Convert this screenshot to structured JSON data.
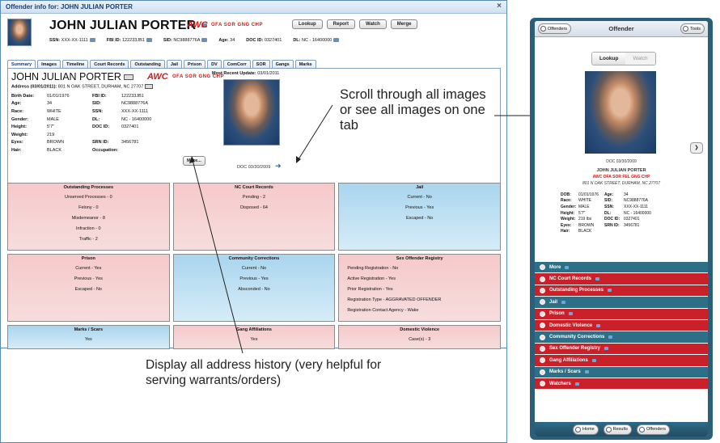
{
  "window": {
    "title": "Offender info for: JOHN JULIAN PORTER",
    "close": "×"
  },
  "header": {
    "name": "JOHN JULIAN PORTER",
    "awc": "AWC",
    "flags": "OFA  SOR  GNG  CHP",
    "buttons": [
      "Lookup",
      "Report",
      "Watch",
      "Merge"
    ],
    "ids": [
      {
        "label": "SSN:",
        "value": "XXX-XX-1111"
      },
      {
        "label": "FBI ID:",
        "value": "122233JB1"
      },
      {
        "label": "SID:",
        "value": "NC9888776A"
      },
      {
        "label": "Age:",
        "value": "34"
      },
      {
        "label": "DOC ID:",
        "value": "0327401"
      },
      {
        "label": "DL:",
        "value": "NC - 16400000"
      }
    ]
  },
  "tabs": [
    "Summary",
    "Images",
    "Timeline",
    "Court Records",
    "Outstanding",
    "Jail",
    "Prison",
    "DV",
    "ComCorr",
    "SOR",
    "Gangs",
    "Marks"
  ],
  "summary": {
    "name": "JOHN JULIAN PORTER",
    "awc": "AWC",
    "flags": "OFA  SOR  GNG  CHP",
    "address_label": "Address (03/01/2011):",
    "address": "801 N OAK STREET, DURHAM, NC 27707",
    "details": [
      [
        "Birth Date:",
        "01/01/1976",
        "FBI ID:",
        "122233JB1"
      ],
      [
        "Age:",
        "34",
        "SID:",
        "NC9888776A"
      ],
      [
        "Race:",
        "WHITE",
        "SSN:",
        "XXX-XX-1111"
      ],
      [
        "Gender:",
        "MALE",
        "DL:",
        "NC - 16400000"
      ],
      [
        "Height:",
        "5'7\"",
        "DOC ID:",
        "0327401"
      ],
      [
        "Weight:",
        "219",
        "",
        ""
      ],
      [
        "Eyes:",
        "BROWN",
        "SRN ID:",
        "3456781"
      ],
      [
        "Hair:",
        "BLACK",
        "Occupation:",
        ""
      ]
    ],
    "more_button": "More...",
    "recent_label": "Most Recent Update:",
    "recent_date": "03/01/2011",
    "photo_caption": "DOC 03/30/2009",
    "next_arrow": "➜"
  },
  "panels": [
    {
      "title": "Outstanding Processes",
      "color": "pink",
      "lines": [
        "Unserved Processes - 0",
        "Felony - 0",
        "Misdemeanor - 8",
        "Infraction - 0",
        "Traffic - 2"
      ]
    },
    {
      "title": "NC Court Records",
      "color": "pink",
      "lines": [
        "Pending - 2",
        "Disposed - 64"
      ]
    },
    {
      "title": "Jail",
      "color": "blue",
      "lines": [
        "Current - No",
        "Previous - Yes",
        "Escaped - No"
      ]
    },
    {
      "title": "Prison",
      "color": "pink",
      "lines": [
        "Current - Yes",
        "Previous - Yes",
        "Escaped - No"
      ]
    },
    {
      "title": "Community Corrections",
      "color": "blue",
      "lines": [
        "Current - No",
        "Previous - Yes",
        "Absconded - No"
      ]
    },
    {
      "title": "Sex Offender Registry",
      "color": "pink",
      "lines": [
        "Pending Registration - No",
        "Active Registration - Yes",
        "Prior Registration - Yes",
        "Registration Type - AGGRAVATED OFFENDER",
        "Registration Contact Agency - Wake"
      ]
    },
    {
      "title": "Marks / Scars",
      "color": "blue",
      "lines": [
        "Yes"
      ]
    },
    {
      "title": "Gang Affiliations",
      "color": "pink",
      "lines": [
        "Yes"
      ]
    },
    {
      "title": "Domestic Violence",
      "color": "pink",
      "lines": [
        "Case(s) - 3"
      ]
    }
  ],
  "annotations": {
    "scroll": "Scroll through all images or see all images on one tab",
    "address": "Display all address history (very helpful for serving warrants/orders)"
  },
  "mobile": {
    "left_button": "Offenders",
    "title": "Offender",
    "right_button": "Tools",
    "toggle": [
      "Lookup",
      "Watch"
    ],
    "doc": "DOC 03/30/2009",
    "name": "JOHN JULIAN PORTER",
    "flags": "AWC OFA SOR FEL GNG CHP",
    "address": "801 N OAK STREET, DURHAM, NC 27707",
    "details": [
      [
        "DOB:",
        "01/01/1976",
        "Age:",
        "34"
      ],
      [
        "Race:",
        "WHITE",
        "SID:",
        "NC9888776A"
      ],
      [
        "Gender:",
        "MALE",
        "SSN:",
        "XXX-XX-1111"
      ],
      [
        "Height:",
        "5'7\"",
        "DL:",
        "NC - 16400000"
      ],
      [
        "Weight:",
        "219 lbs",
        "DOC ID:",
        "0327401"
      ],
      [
        "Eyes:",
        "BROWN",
        "SRN ID:",
        "3456781"
      ],
      [
        "Hair:",
        "BLACK",
        "",
        ""
      ]
    ],
    "menu": [
      {
        "label": "More",
        "color": "teal"
      },
      {
        "label": "NC Court Records",
        "color": "red"
      },
      {
        "label": "Outstanding Processes",
        "color": "red"
      },
      {
        "label": "Jail",
        "color": "teal"
      },
      {
        "label": "Prison",
        "color": "red"
      },
      {
        "label": "Domestic Violence",
        "color": "red"
      },
      {
        "label": "Community Corrections",
        "color": "teal"
      },
      {
        "label": "Sex Offender Registry",
        "color": "red"
      },
      {
        "label": "Gang Affiliations",
        "color": "red"
      },
      {
        "label": "Marks / Scars",
        "color": "teal"
      },
      {
        "label": "Watchers",
        "color": "red"
      }
    ],
    "bottom": [
      "Home",
      "Results",
      "Offenders"
    ]
  },
  "colors": {
    "accent": "#d21919",
    "panel_pink": "#f6c9ca",
    "panel_blue": "#a9d5ee",
    "menu_teal": "#2c6f86",
    "menu_red": "#c9202a"
  }
}
